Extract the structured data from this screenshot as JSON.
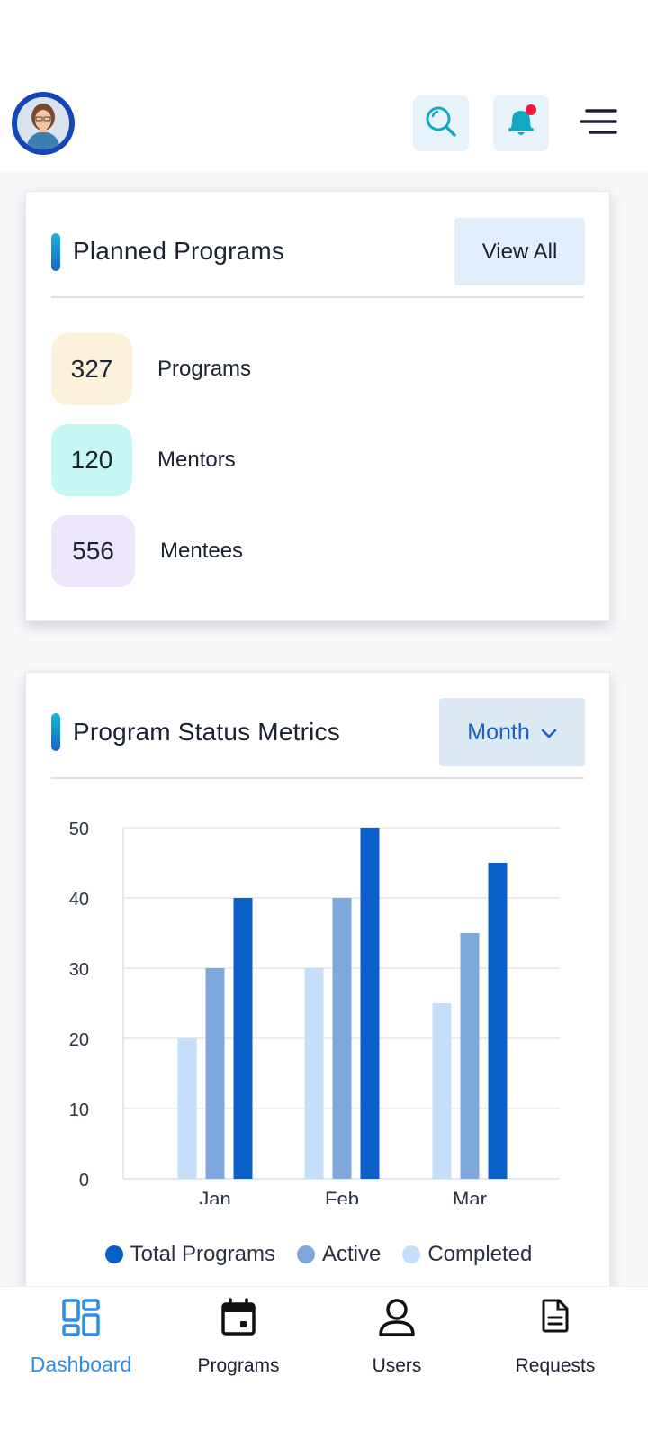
{
  "header": {
    "avatar_alt": "profile photo",
    "search_icon": "search-icon",
    "bell_icon": "bell-icon",
    "menu_icon": "menu-icon",
    "notification_color": "#f0183c",
    "accent_color": "#1ab0c9"
  },
  "planned_programs": {
    "title": "Planned Programs",
    "view_all_label": "View All",
    "stats": [
      {
        "value": "327",
        "label": "Programs",
        "color": "#fdf1dc"
      },
      {
        "value": "120",
        "label": "Mentors",
        "color": "#c7f7f4"
      },
      {
        "value": "556",
        "label": "Mentees",
        "color": "#ede6fb"
      }
    ]
  },
  "status_metrics": {
    "title": "Program Status Metrics",
    "period_label": "Month"
  },
  "chart_data": {
    "type": "bar",
    "categories": [
      "Jan",
      "Feb",
      "Mar"
    ],
    "series": [
      {
        "name": "Completed",
        "values": [
          20,
          30,
          25
        ],
        "color": "#c5def9"
      },
      {
        "name": "Active",
        "values": [
          30,
          40,
          35
        ],
        "color": "#7ea7db"
      },
      {
        "name": "Total Programs",
        "values": [
          40,
          50,
          45
        ],
        "color": "#0a5fc8"
      }
    ],
    "yticks": [
      0,
      10,
      20,
      30,
      40,
      50
    ],
    "ylim": [
      0,
      50
    ],
    "grid": true,
    "legend": [
      "Total Programs",
      "Active",
      "Completed"
    ],
    "legend_placement": "bottom"
  },
  "nav": {
    "items": [
      {
        "label": "Dashboard",
        "icon": "dashboard-icon",
        "active": true
      },
      {
        "label": "Programs",
        "icon": "calendar-icon",
        "active": false
      },
      {
        "label": "Users",
        "icon": "user-icon",
        "active": false
      },
      {
        "label": "Requests",
        "icon": "document-icon",
        "active": false
      }
    ],
    "active_color": "#2f8bea"
  }
}
